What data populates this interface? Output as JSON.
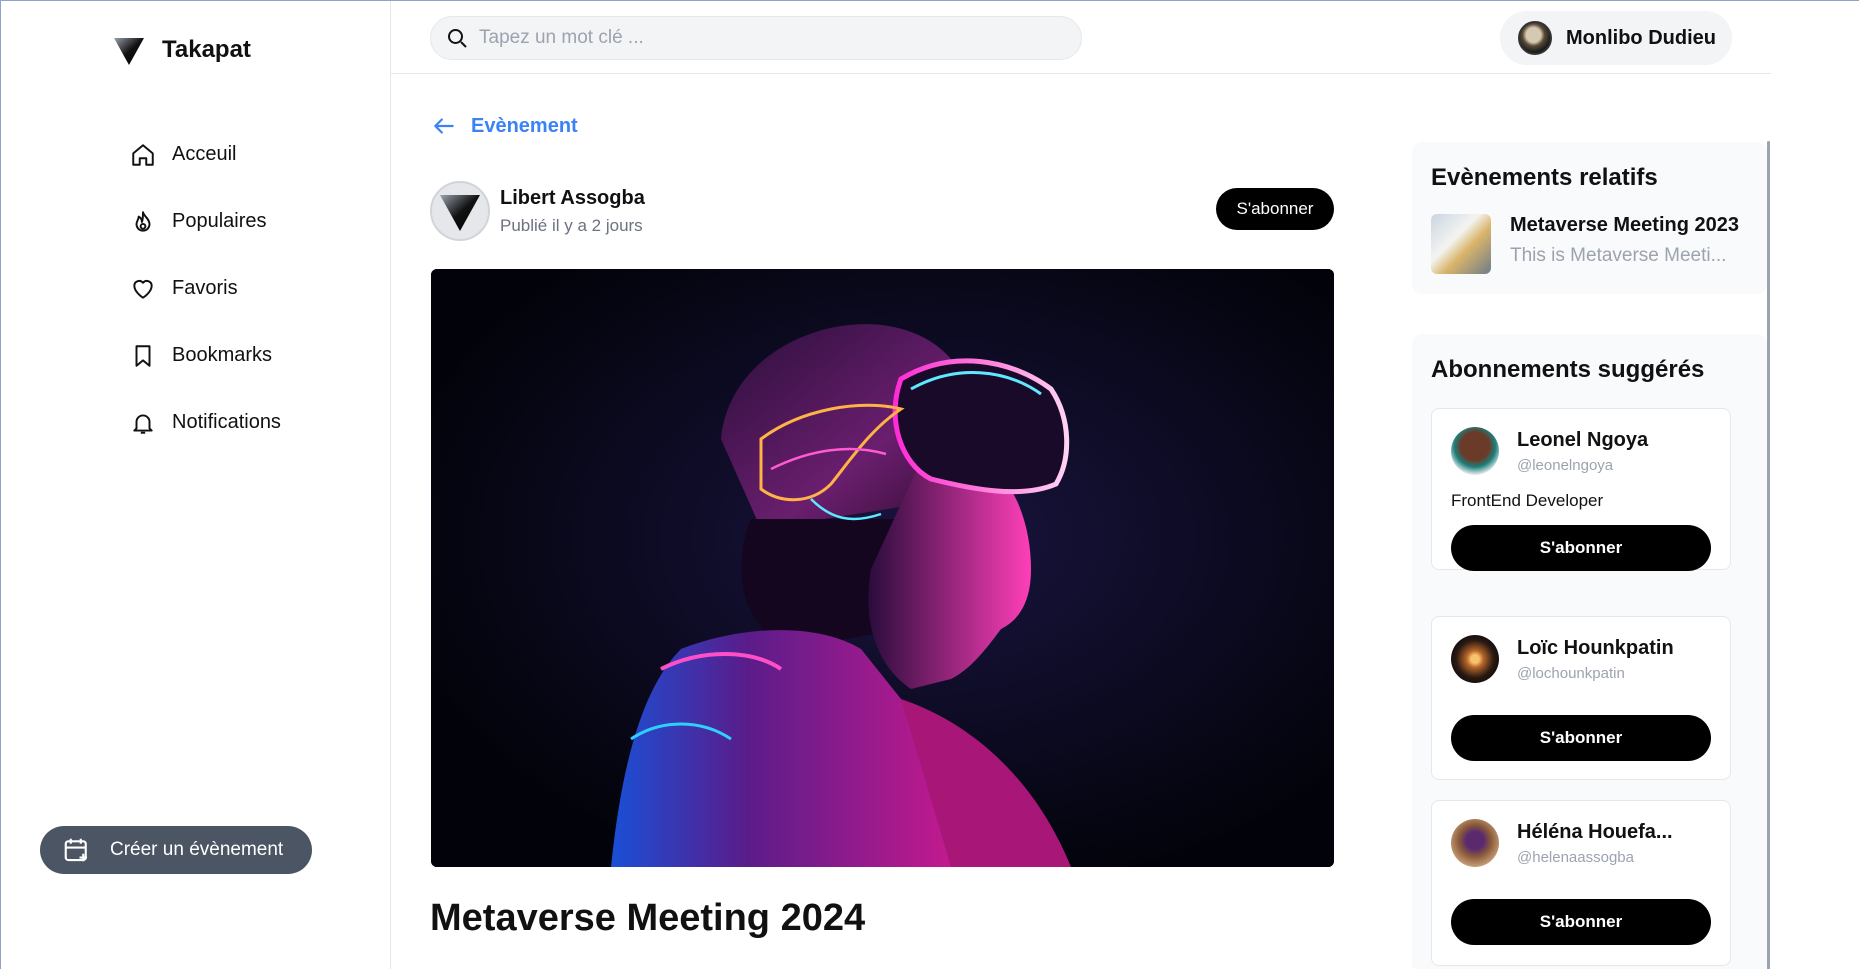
{
  "app": {
    "name": "Takapat"
  },
  "sidebar": {
    "items": [
      {
        "label": "Acceuil",
        "icon": "home-icon"
      },
      {
        "label": "Populaires",
        "icon": "flame-icon"
      },
      {
        "label": "Favoris",
        "icon": "heart-icon"
      },
      {
        "label": "Bookmarks",
        "icon": "bookmark-icon"
      },
      {
        "label": "Notifications",
        "icon": "bell-icon"
      }
    ],
    "create_label": "Créer un évènement"
  },
  "header": {
    "search_placeholder": "Tapez un mot clé ...",
    "user_name": "Monlibo Dudieu"
  },
  "main": {
    "back_label": "Evènement",
    "author_name": "Libert Assogba",
    "published": "Publié il y a 2 jours",
    "subscribe_label": "S'abonner",
    "event_title": "Metaverse Meeting 2024"
  },
  "related": {
    "title": "Evènements relatifs",
    "items": [
      {
        "title": "Metaverse Meeting 2023",
        "desc": "This is Metaverse Meeti..."
      }
    ]
  },
  "suggestions": {
    "title": "Abonnements suggérés",
    "users": [
      {
        "name": "Leonel Ngoya",
        "handle": "@leonelngoya",
        "bio": "FrontEnd Developer",
        "button": "S'abonner"
      },
      {
        "name": "Loïc Hounkpatin",
        "handle": "@lochounkpatin",
        "bio": "",
        "button": "S'abonner"
      },
      {
        "name": "Héléna Houefa...",
        "handle": "@helenaassogba",
        "bio": "",
        "button": "S'abonner"
      }
    ]
  },
  "colors": {
    "accent": "#3b82f6",
    "primary_button": "#000000",
    "create_button": "#4b5563"
  }
}
